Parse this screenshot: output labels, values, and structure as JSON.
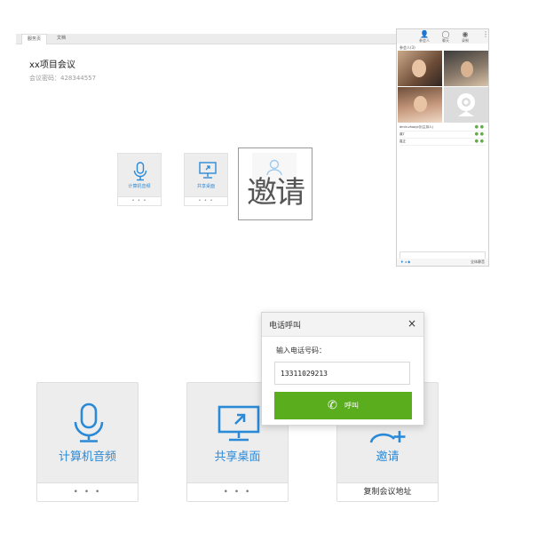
{
  "small_window": {
    "tabs": [
      {
        "label": "服务页"
      },
      {
        "label": "文档"
      }
    ],
    "meeting_title": "xx项目会议",
    "meeting_password": "会议密码：428344557",
    "cards": [
      {
        "label": "计算机音频",
        "footer": "• • •"
      },
      {
        "label": "共享桌面",
        "footer": "• • •"
      },
      {
        "label": "邀请",
        "footer": "• • •"
      }
    ],
    "invite_zoom_label": "邀请",
    "right_panel": {
      "top_icons": [
        {
          "glyph": "👤",
          "label": "参会人"
        },
        {
          "glyph": "◯",
          "label": "聊天"
        },
        {
          "glyph": "◉",
          "label": "录制"
        },
        {
          "glyph": "⋮",
          "label": ""
        }
      ],
      "video_header": "参会人(3)",
      "participants": [
        {
          "name": "dmin.zhaoyi@(主持人)"
        },
        {
          "name": "鼎T"
        },
        {
          "name": "嘉正"
        }
      ],
      "bottom_right": "全体静音"
    }
  },
  "cards": [
    {
      "label": "计算机音频",
      "footer": "• • •",
      "icon": "microphone-icon"
    },
    {
      "label": "共享桌面",
      "footer": "• • •",
      "icon": "share-desktop-icon"
    },
    {
      "label": "邀请",
      "footer": "复制会议地址",
      "icon": "add-user-icon"
    }
  ],
  "dialog": {
    "title": "电话呼叫",
    "close": "×",
    "prompt": "输入电话号码：",
    "phone_value": "13311029213",
    "call_label": "呼叫",
    "call_color": "#5aae1d"
  },
  "colors": {
    "accent": "#2b8ad8",
    "card_bg": "#ededed"
  }
}
